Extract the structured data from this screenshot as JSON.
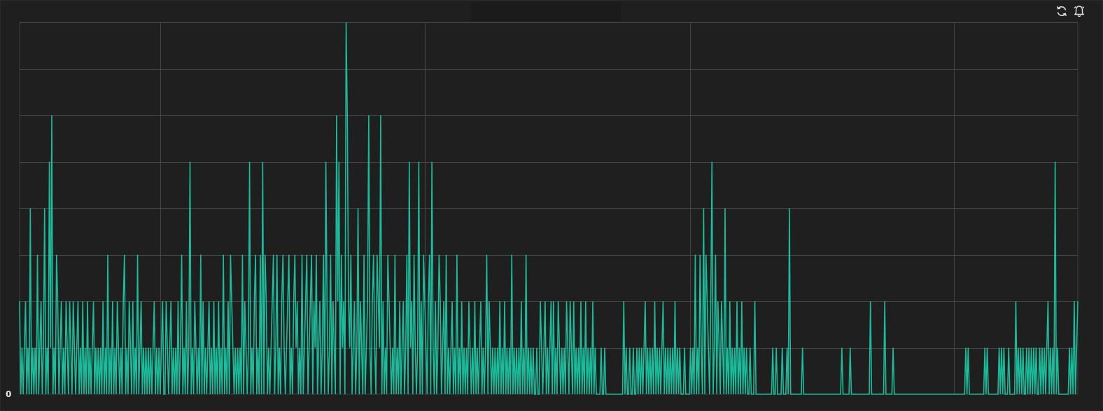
{
  "panel": {
    "title": "",
    "accent_color": "#1abc9c",
    "grid_color": "#444444",
    "background": "#1f1f1f",
    "icons": [
      "refresh-icon",
      "alarm-bell-icon"
    ]
  },
  "chart_data": {
    "type": "line",
    "title": "",
    "xlabel": "",
    "ylabel": "",
    "y_zero_label": "0",
    "ylim": [
      0,
      8
    ],
    "grid": true,
    "legend": "none",
    "series": [
      {
        "color": "#1abc9c",
        "values": [
          2,
          0,
          1,
          0,
          1,
          2,
          0,
          1,
          0,
          4,
          0,
          1,
          0,
          1,
          0,
          3,
          0,
          1,
          2,
          0,
          1,
          4,
          0,
          1,
          0,
          5,
          1,
          6,
          0,
          1,
          0,
          3,
          2,
          0,
          1,
          2,
          0,
          1,
          0,
          2,
          1,
          0,
          2,
          1,
          0,
          2,
          1,
          0,
          1,
          2,
          0,
          1,
          0,
          2,
          0,
          1,
          0,
          2,
          0,
          1,
          0,
          1,
          2,
          0,
          1,
          0,
          1,
          0,
          1,
          0,
          2,
          0,
          1,
          0,
          3,
          0,
          1,
          0,
          2,
          0,
          1,
          0,
          2,
          1,
          0,
          1,
          0,
          2,
          3,
          0,
          1,
          0,
          2,
          1,
          0,
          2,
          0,
          1,
          0,
          3,
          0,
          1,
          2,
          0,
          1,
          0,
          1,
          0,
          1,
          0,
          1,
          0,
          1,
          2,
          0,
          1,
          0,
          1,
          0,
          1,
          2,
          0,
          0,
          2,
          1,
          0,
          1,
          2,
          0,
          1,
          0,
          1,
          0,
          2,
          0,
          1,
          3,
          0,
          1,
          0,
          2,
          0,
          1,
          5,
          0,
          1,
          0,
          2,
          1,
          0,
          1,
          0,
          3,
          0,
          2,
          0,
          1,
          0,
          1,
          2,
          0,
          1,
          0,
          2,
          0,
          1,
          0,
          2,
          0,
          1,
          0,
          3,
          0,
          1,
          0,
          2,
          0,
          3,
          2,
          1,
          0,
          1,
          0,
          1,
          0,
          1,
          0,
          3,
          0,
          2,
          1,
          0,
          1,
          5,
          0,
          1,
          0,
          2,
          3,
          0,
          1,
          0,
          3,
          0,
          5,
          0,
          3,
          2,
          0,
          1,
          0,
          1,
          2,
          3,
          0,
          1,
          3,
          0,
          1,
          0,
          2,
          3,
          1,
          0,
          1,
          2,
          3,
          0,
          1,
          0,
          2,
          3,
          1,
          2,
          0,
          1,
          0,
          3,
          0,
          1,
          2,
          3,
          0,
          1,
          2,
          3,
          0,
          2,
          1,
          3,
          0,
          1,
          2,
          0,
          1,
          3,
          0,
          5,
          2,
          0,
          1,
          3,
          0,
          2,
          1,
          0,
          6,
          2,
          5,
          0,
          3,
          1,
          2,
          0,
          8,
          6,
          2,
          1,
          3,
          0,
          1,
          2,
          0,
          1,
          4,
          0,
          2,
          1,
          0,
          3,
          0,
          1,
          2,
          6,
          1,
          0,
          2,
          3,
          1,
          0,
          3,
          2,
          1,
          6,
          0,
          2,
          0,
          1,
          0,
          3,
          2,
          1,
          0,
          1,
          0,
          3,
          0,
          1,
          0,
          2,
          0,
          1,
          2,
          0,
          1,
          3,
          0,
          5,
          1,
          2,
          0,
          3,
          1,
          0,
          1,
          5,
          0,
          2,
          0,
          3,
          2,
          1,
          0,
          2,
          3,
          0,
          5,
          1,
          0,
          2,
          0,
          1,
          3,
          2,
          0,
          1,
          2,
          0,
          3,
          0,
          1,
          0,
          1,
          2,
          0,
          1,
          0,
          3,
          0,
          1,
          0,
          2,
          0,
          1,
          0,
          1,
          0,
          2,
          1,
          0,
          1,
          0,
          2,
          0,
          1,
          0,
          1,
          2,
          0,
          1,
          0,
          1,
          3,
          0,
          2,
          1,
          0,
          1,
          0,
          1,
          0,
          1,
          0,
          2,
          0,
          1,
          0,
          2,
          0,
          1,
          0,
          1,
          0,
          3,
          0,
          1,
          0,
          1,
          0,
          1,
          0,
          2,
          0,
          1,
          0,
          3,
          0,
          1,
          0,
          1,
          0,
          1,
          0,
          0,
          1,
          0,
          0,
          2,
          1,
          0,
          1,
          2,
          0,
          1,
          0,
          1,
          2,
          0,
          2,
          0,
          1,
          0,
          2,
          1,
          0,
          1,
          0,
          1,
          0,
          2,
          1,
          0,
          2,
          1,
          0,
          2,
          0,
          1,
          0,
          1,
          0,
          2,
          0,
          1,
          0,
          2,
          0,
          1,
          0,
          1,
          0,
          2,
          0,
          1,
          0,
          0,
          0,
          0,
          1,
          0,
          0,
          1,
          0,
          0,
          0,
          0,
          0,
          0,
          0,
          0,
          0,
          0,
          0,
          0,
          0,
          0,
          0,
          2,
          0,
          1,
          0,
          0,
          1,
          0,
          0,
          1,
          0,
          0,
          1,
          0,
          1,
          0,
          1,
          0,
          1,
          2,
          0,
          1,
          0,
          1,
          0,
          1,
          0,
          2,
          0,
          1,
          0,
          1,
          0,
          1,
          2,
          0,
          1,
          0,
          1,
          0,
          1,
          0,
          1,
          0,
          2,
          0,
          1,
          0,
          1,
          0,
          0,
          0,
          1,
          0,
          0,
          0,
          0,
          1,
          0,
          1,
          0,
          3,
          0,
          1,
          0,
          3,
          1,
          0,
          4,
          0,
          3,
          2,
          1,
          0,
          2,
          5,
          0,
          1,
          3,
          0,
          2,
          1,
          0,
          2,
          1,
          0,
          4,
          0,
          1,
          0,
          2,
          0,
          1,
          0,
          1,
          0,
          2,
          0,
          1,
          0,
          2,
          0,
          1,
          0,
          1,
          0,
          0,
          1,
          0,
          0,
          0,
          2,
          0,
          0,
          0,
          0,
          0,
          0,
          0,
          0,
          0,
          0,
          0,
          0,
          0,
          0,
          1,
          0,
          0,
          1,
          0,
          0,
          0,
          0,
          1,
          0,
          0,
          0,
          1,
          0,
          4,
          0,
          0,
          0,
          0,
          0,
          0,
          0,
          0,
          0,
          0,
          1,
          0,
          0,
          0,
          0,
          0,
          0,
          0,
          0,
          0,
          0,
          0,
          0,
          0,
          0,
          0,
          0,
          0,
          0,
          0,
          0,
          0,
          0,
          0,
          0,
          0,
          0,
          0,
          0,
          0,
          0,
          0,
          0,
          1,
          0,
          0,
          0,
          0,
          0,
          0,
          1,
          0,
          0,
          0,
          0,
          0,
          0,
          0,
          0,
          0,
          0,
          0,
          0,
          0,
          0,
          0,
          0,
          2,
          0,
          0,
          0,
          0,
          0,
          0,
          0,
          0,
          0,
          0,
          0,
          2,
          0,
          0,
          0,
          0,
          0,
          0,
          1,
          0,
          0,
          0,
          0,
          0,
          0,
          0,
          0,
          0,
          0,
          0,
          0,
          0,
          0,
          0,
          0,
          0,
          0,
          0,
          0,
          0,
          0,
          0,
          0,
          0,
          0,
          0,
          0,
          0,
          0,
          0,
          0,
          0,
          0,
          0,
          0,
          0,
          0,
          0,
          0,
          0,
          0,
          0,
          0,
          0,
          0,
          0,
          0,
          0,
          0,
          0,
          0,
          0,
          0,
          0,
          0,
          0,
          0,
          0,
          0,
          1,
          0,
          1,
          0,
          0,
          0,
          0,
          0,
          0,
          0,
          0,
          0,
          0,
          0,
          0,
          0,
          1,
          0,
          1,
          0,
          0,
          0,
          0,
          0,
          0,
          0,
          0,
          0,
          1,
          0,
          1,
          0,
          1,
          0,
          0,
          0,
          1,
          0,
          0,
          0,
          0,
          0,
          2,
          0,
          1,
          0,
          1,
          0,
          1,
          0,
          0,
          1,
          0,
          1,
          0,
          1,
          0,
          1,
          0,
          1,
          0,
          0,
          1,
          0,
          1,
          0,
          1,
          0,
          1,
          2,
          0,
          1,
          0,
          1,
          0,
          5,
          0,
          1,
          0,
          0,
          0,
          0,
          0,
          0,
          0,
          0,
          0,
          1,
          0,
          1,
          0,
          2,
          0,
          1,
          2
        ]
      }
    ]
  }
}
